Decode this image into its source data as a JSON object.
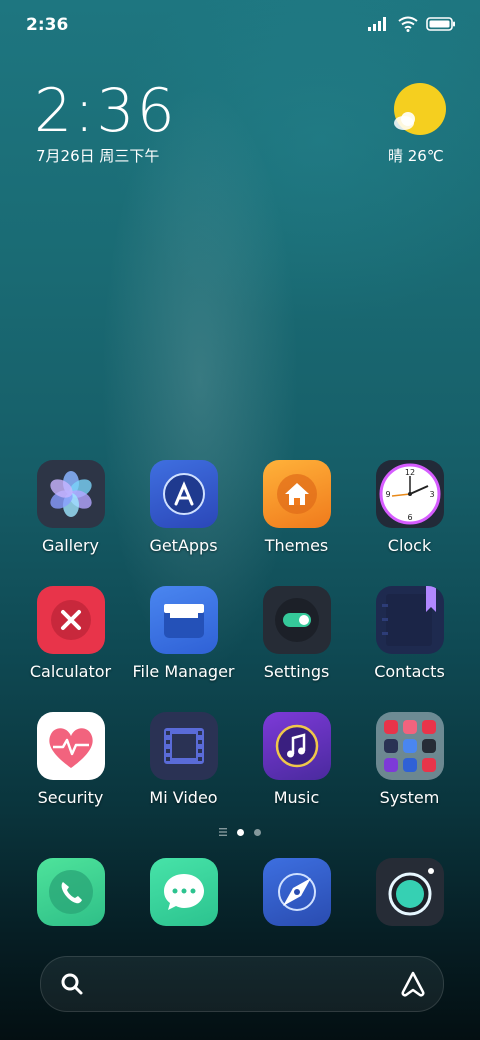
{
  "status": {
    "time": "2:36"
  },
  "clock": {
    "time": "2:36",
    "date": "7月26日 周三下午"
  },
  "weather": {
    "text": "晴 26℃"
  },
  "apps": [
    {
      "label": "Gallery",
      "icon": "gallery-icon"
    },
    {
      "label": "GetApps",
      "icon": "getapps-icon"
    },
    {
      "label": "Themes",
      "icon": "themes-icon"
    },
    {
      "label": "Clock",
      "icon": "clock-icon"
    },
    {
      "label": "Calculator",
      "icon": "calculator-icon"
    },
    {
      "label": "File Manager",
      "icon": "file-manager-icon"
    },
    {
      "label": "Settings",
      "icon": "settings-icon"
    },
    {
      "label": "Contacts",
      "icon": "contacts-icon"
    },
    {
      "label": "Security",
      "icon": "security-icon"
    },
    {
      "label": "Mi Video",
      "icon": "mi-video-icon"
    },
    {
      "label": "Music",
      "icon": "music-icon"
    },
    {
      "label": "System",
      "icon": "system-folder-icon"
    }
  ],
  "dock": [
    "phone-icon",
    "messages-icon",
    "browser-icon",
    "camera-icon"
  ],
  "colors": {
    "accent": "#f5cf1f",
    "bg_top": "#1e7680",
    "bg_bottom": "#040f12"
  }
}
